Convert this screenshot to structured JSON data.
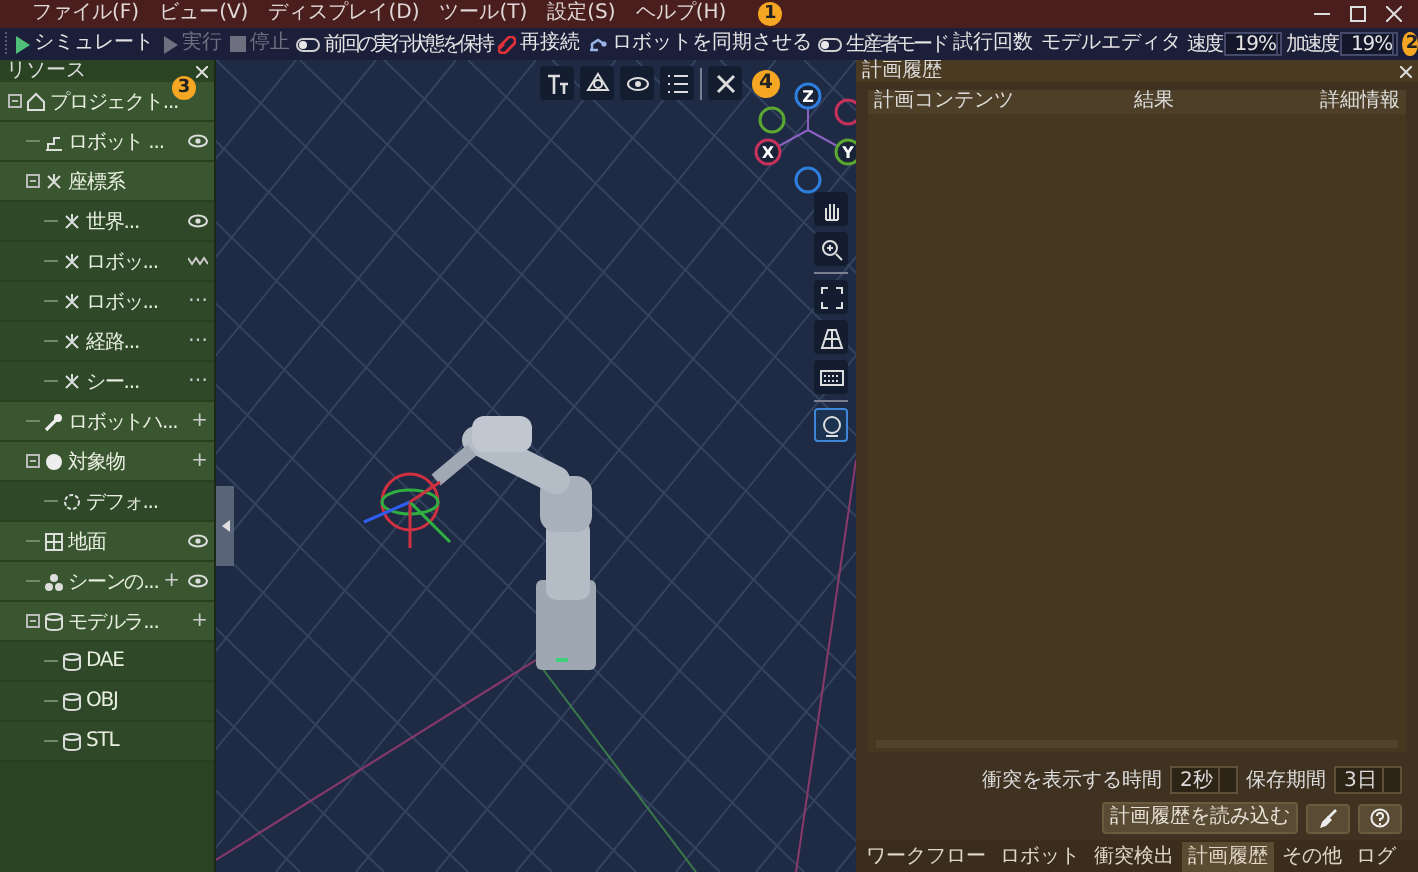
{
  "menu_bar": {
    "items": [
      "ファイル(F)",
      "ビュー(V)",
      "ディスプレイ(D)",
      "ツール(T)",
      "設定(S)",
      "ヘルプ(H)"
    ],
    "badge": "1"
  },
  "toolbar": {
    "items": [
      {
        "kind": "simulate",
        "label": "シミュレート",
        "disabled": false
      },
      {
        "kind": "run",
        "label": "実行",
        "disabled": true
      },
      {
        "kind": "stop",
        "label": "停止",
        "disabled": true
      },
      {
        "kind": "toggle",
        "label": "前回の実行状態を保持",
        "on": false
      },
      {
        "kind": "reconnect",
        "label": "再接続",
        "disabled": false
      },
      {
        "kind": "sync",
        "label": "ロボットを同期させる",
        "disabled": false
      },
      {
        "kind": "toggle",
        "label": "生産者モード",
        "on": false
      },
      {
        "kind": "text",
        "label": "試行回数"
      },
      {
        "kind": "text",
        "label": "モデルエディタ"
      },
      {
        "kind": "spin",
        "label": "速度",
        "value": "19%"
      },
      {
        "kind": "spin",
        "label": "加速度",
        "value": "19%"
      }
    ],
    "badge": "2"
  },
  "resources": {
    "title": "リソース",
    "badge": "3",
    "tree": [
      {
        "label": "プロジェクト...",
        "kind": "project",
        "expanded": true,
        "children": [
          {
            "label": "ロボット ...",
            "kind": "robot",
            "visible": true
          },
          {
            "label": "座標系",
            "kind": "frame",
            "expanded": true,
            "children": [
              {
                "label": "世界...",
                "kind": "frame",
                "visible": true
              },
              {
                "label": "ロボッ...",
                "kind": "frame",
                "visible": false
              },
              {
                "label": "ロボッ...",
                "kind": "frame",
                "actions": [
                  "⋯"
                ]
              },
              {
                "label": "経路...",
                "kind": "frame",
                "actions": [
                  "⋯"
                ]
              },
              {
                "label": "シー...",
                "kind": "frame",
                "actions": [
                  "⋯"
                ]
              }
            ]
          },
          {
            "label": "ロボットハ...",
            "kind": "tool",
            "actions": [
              "+"
            ]
          },
          {
            "label": "対象物",
            "kind": "object",
            "expanded": true,
            "actions": [
              "+"
            ],
            "children": [
              {
                "label": "デフォ...",
                "kind": "part"
              }
            ]
          },
          {
            "label": "地面",
            "kind": "ground",
            "visible": true
          },
          {
            "label": "シーンの...",
            "kind": "scene",
            "actions": [
              "+"
            ],
            "visible": true
          },
          {
            "label": "モデルラ...",
            "kind": "library",
            "expanded": true,
            "actions": [
              "+"
            ],
            "children": [
              {
                "label": "DAE",
                "kind": "library"
              },
              {
                "label": "OBJ",
                "kind": "library"
              },
              {
                "label": "STL",
                "kind": "library"
              }
            ]
          }
        ]
      }
    ]
  },
  "viewport": {
    "badge": "4",
    "axes": [
      {
        "label": "Z",
        "color": "#2f7fe0"
      },
      {
        "label": "X",
        "color": "#c8325a"
      },
      {
        "label": "Y",
        "color": "#5aa832"
      }
    ],
    "side_tools": [
      {
        "kind": "hand",
        "selected": false
      },
      {
        "kind": "zoom",
        "selected": false
      },
      {
        "kind": "fit",
        "selected": false
      },
      {
        "kind": "perspective",
        "selected": false
      },
      {
        "kind": "keyboard",
        "selected": false
      },
      {
        "kind": "focus",
        "selected": true
      }
    ]
  },
  "plan_history": {
    "title": "計画履歴",
    "columns": [
      "計画コンテンツ",
      "結果",
      "詳細情報"
    ],
    "collision_time_label": "衝突を表示する時間",
    "collision_time": "2秒",
    "retention_label": "保存期間",
    "retention": "3日",
    "load_button": "計画履歴を読み込む",
    "tabs": [
      {
        "label": "ワークフロー",
        "selected": false
      },
      {
        "label": "ロボット",
        "selected": false
      },
      {
        "label": "衝突検出",
        "selected": false
      },
      {
        "label": "計画履歴",
        "selected": true
      },
      {
        "label": "その他",
        "selected": false
      },
      {
        "label": "ログ",
        "selected": false
      }
    ]
  }
}
